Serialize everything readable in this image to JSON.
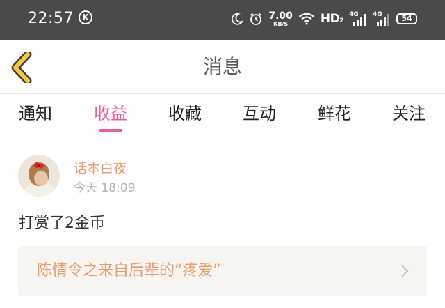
{
  "status_bar": {
    "time": "22:57",
    "app_badge": "K",
    "net_speed_value": "7.00",
    "net_speed_unit": "KB/S",
    "hd_label": "HD",
    "hd_sub": "2",
    "sim1_label": "4G",
    "sim2_label": "4G",
    "battery": "54"
  },
  "header": {
    "title": "消息"
  },
  "tabs": [
    {
      "label": "通知",
      "active": false
    },
    {
      "label": "收益",
      "active": true
    },
    {
      "label": "收藏",
      "active": false
    },
    {
      "label": "互动",
      "active": false
    },
    {
      "label": "鲜花",
      "active": false
    },
    {
      "label": "关注",
      "active": false
    }
  ],
  "message": {
    "sender": "话本白夜",
    "time": "今天 18:09",
    "text": "打赏了2金币",
    "card_title": "陈情令之来自后辈的“疼爱”"
  },
  "colors": {
    "status_bar_bg": "#4a4a4a",
    "accent_pink": "#e8609b",
    "accent_orange": "#e89a6e",
    "back_arrow": "#f5c842",
    "card_bg": "#f6f5f1"
  }
}
